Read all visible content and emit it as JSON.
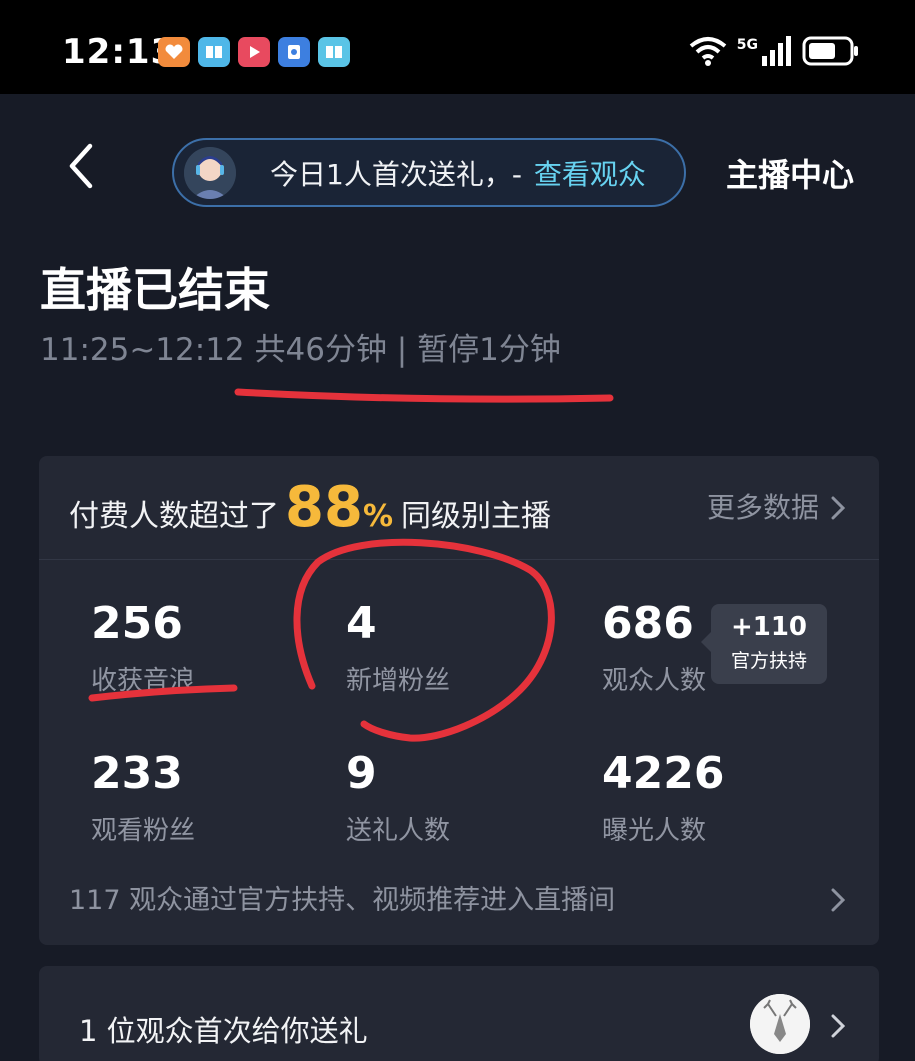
{
  "status_bar": {
    "time": "12:13",
    "network": "5G",
    "app_icons": [
      "reading-app-icon",
      "book-app-icon",
      "video-app-icon",
      "shield-app-icon",
      "book2-app-icon"
    ]
  },
  "header": {
    "notice_text": "今日1人首次送礼，-",
    "notice_link": "查看观众",
    "right_title": "主播中心"
  },
  "summary": {
    "title": "直播已结束",
    "subtitle": "11:25~12:12 共46分钟 | 暂停1分钟"
  },
  "stats_card": {
    "headline_pre": "付费人数超过了",
    "headline_number": "88",
    "headline_unit": "%",
    "headline_post": "同级别主播",
    "more_label": "更多数据",
    "stats": [
      {
        "value": "256",
        "label": "收获音浪"
      },
      {
        "value": "4",
        "label": "新增粉丝"
      },
      {
        "value": "686",
        "label": "观众人数"
      },
      {
        "value": "233",
        "label": "观看粉丝"
      },
      {
        "value": "9",
        "label": "送礼人数"
      },
      {
        "value": "4226",
        "label": "曝光人数"
      }
    ],
    "tooltip": {
      "value": "+110",
      "label": "官方扶持"
    },
    "footnote": "117 观众通过官方扶持、视频推荐进入直播间"
  },
  "gift_card": {
    "text": "1 位观众首次给你送礼"
  },
  "colors": {
    "background": "#171b26",
    "card": "#242834",
    "accent_gold": "#f6b93b",
    "link_cyan": "#67d2f0",
    "annotation_red": "#e5323b"
  }
}
